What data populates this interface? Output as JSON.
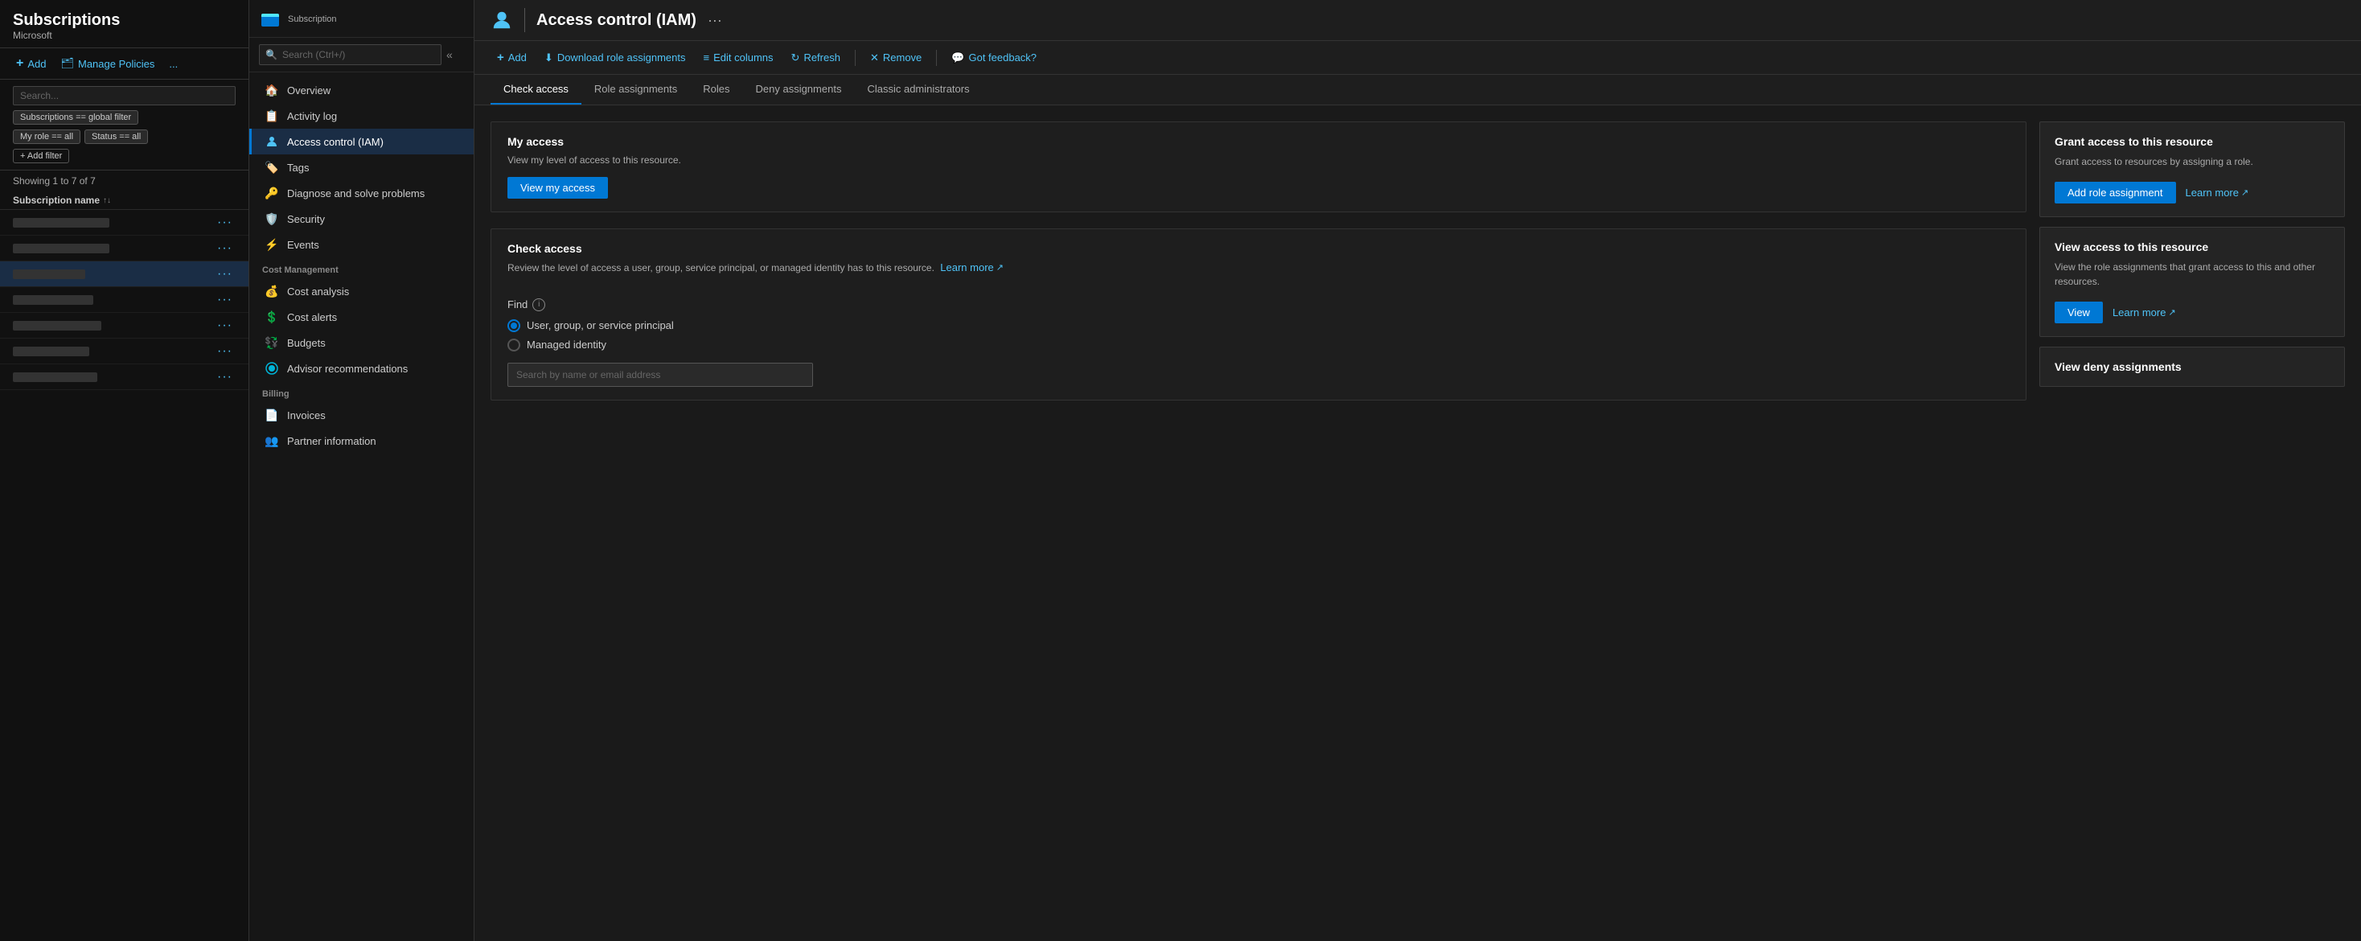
{
  "left_panel": {
    "title": "Subscriptions",
    "subtitle": "Microsoft",
    "toolbar": {
      "add_label": "Add",
      "manage_label": "Manage Policies",
      "more_label": "..."
    },
    "filters": {
      "search_placeholder": "Search...",
      "chips": [
        "Subscriptions == global filter",
        "My role == all",
        "Status == all"
      ],
      "add_filter_label": "+ Add filter"
    },
    "showing_text": "Showing 1 to 7 of 7",
    "col_header": "Subscription name",
    "rows": [
      {
        "id": 1,
        "name": "",
        "redacted": true
      },
      {
        "id": 2,
        "name": "",
        "redacted": true
      },
      {
        "id": 3,
        "name": "",
        "redacted": true,
        "selected": true
      },
      {
        "id": 4,
        "name": "",
        "redacted": true
      },
      {
        "id": 5,
        "name": "",
        "redacted": true
      },
      {
        "id": 6,
        "name": "",
        "redacted": true
      },
      {
        "id": 7,
        "name": "",
        "redacted": true
      }
    ]
  },
  "middle_panel": {
    "icon_label": "subscription-icon",
    "breadcrumb": "Subscription",
    "search_placeholder": "Search (Ctrl+/)",
    "nav_items": [
      {
        "id": "overview",
        "label": "Overview",
        "icon": "🏠",
        "active": false,
        "section": ""
      },
      {
        "id": "activity-log",
        "label": "Activity log",
        "icon": "📋",
        "active": false,
        "section": ""
      },
      {
        "id": "access-control",
        "label": "Access control (IAM)",
        "icon": "👤",
        "active": true,
        "section": ""
      },
      {
        "id": "tags",
        "label": "Tags",
        "icon": "🏷️",
        "active": false,
        "section": ""
      },
      {
        "id": "diagnose",
        "label": "Diagnose and solve problems",
        "icon": "🔑",
        "active": false,
        "section": ""
      },
      {
        "id": "security",
        "label": "Security",
        "icon": "🛡️",
        "active": false,
        "section": ""
      },
      {
        "id": "events",
        "label": "Events",
        "icon": "⚡",
        "active": false,
        "section": ""
      }
    ],
    "sections": [
      {
        "label": "Cost Management",
        "items": [
          {
            "id": "cost-analysis",
            "label": "Cost analysis",
            "icon": "💰"
          },
          {
            "id": "cost-alerts",
            "label": "Cost alerts",
            "icon": "💲"
          },
          {
            "id": "budgets",
            "label": "Budgets",
            "icon": "💱"
          },
          {
            "id": "advisor",
            "label": "Advisor recommendations",
            "icon": "🔵"
          }
        ]
      },
      {
        "label": "Billing",
        "items": [
          {
            "id": "invoices",
            "label": "Invoices",
            "icon": "📄"
          },
          {
            "id": "partner",
            "label": "Partner information",
            "icon": "👥"
          }
        ]
      }
    ]
  },
  "main": {
    "header": {
      "title": "Access control (IAM)",
      "more_label": "···"
    },
    "toolbar": {
      "add_label": "Add",
      "download_label": "Download role assignments",
      "edit_columns_label": "Edit columns",
      "refresh_label": "Refresh",
      "remove_label": "Remove",
      "feedback_label": "Got feedback?"
    },
    "tabs": [
      {
        "id": "check-access",
        "label": "Check access",
        "active": true
      },
      {
        "id": "role-assignments",
        "label": "Role assignments",
        "active": false
      },
      {
        "id": "roles",
        "label": "Roles",
        "active": false
      },
      {
        "id": "deny-assignments",
        "label": "Deny assignments",
        "active": false
      },
      {
        "id": "classic-admins",
        "label": "Classic administrators",
        "active": false
      }
    ],
    "my_access": {
      "title": "My access",
      "description": "View my level of access to this resource.",
      "button_label": "View my access"
    },
    "check_access": {
      "title": "Check access",
      "description": "Review the level of access a user, group, service principal, or managed identity has to this resource.",
      "learn_more_label": "Learn more",
      "find_label": "Find",
      "radio_options": [
        {
          "id": "user-group",
          "label": "User, group, or service principal",
          "checked": true
        },
        {
          "id": "managed-identity",
          "label": "Managed identity",
          "checked": false
        }
      ],
      "search_placeholder": "Search by name or email address"
    },
    "grant_access": {
      "title": "Grant access to this resource",
      "description": "Grant access to resources by assigning a role.",
      "add_role_label": "Add role assignment",
      "learn_more_label": "Learn more"
    },
    "view_access": {
      "title": "View access to this resource",
      "description": "View the role assignments that grant access to this and other resources.",
      "view_label": "View",
      "learn_more_label": "Learn more"
    },
    "view_deny": {
      "title": "View deny assignments"
    }
  }
}
